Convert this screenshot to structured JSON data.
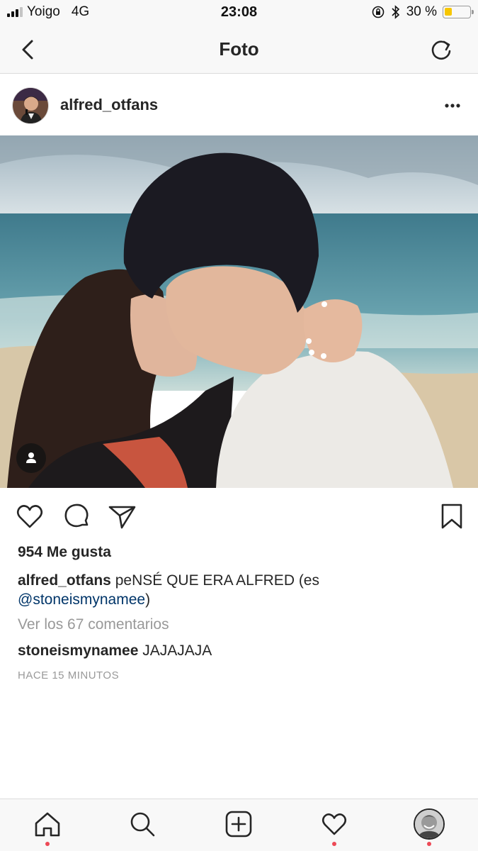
{
  "status_bar": {
    "carrier": "Yoigo",
    "network": "4G",
    "time": "23:08",
    "battery_text": "30 %",
    "battery_level": 0.3,
    "battery_color": "#f7c600"
  },
  "nav": {
    "title": "Foto",
    "back_icon": "chevron-left-icon",
    "refresh_icon": "refresh-icon"
  },
  "post": {
    "username": "alfred_otfans",
    "more_icon": "more-horizontal-icon",
    "tag_icon": "person-tag-icon",
    "likes": "954 Me gusta",
    "caption_user": "alfred_otfans",
    "caption_text": "peNSÉ QUE ERA ALFRED (es",
    "caption_mention": "@stoneismynamee",
    "caption_end": ")",
    "view_comments": "Ver los 67 comentarios",
    "comment_user": "stoneismynamee",
    "comment_text": "JAJAJAJA",
    "timestamp": "HACE 15 MINUTOS"
  },
  "actions": {
    "like_icon": "heart-icon",
    "comment_icon": "comment-icon",
    "share_icon": "send-icon",
    "save_icon": "bookmark-icon"
  },
  "tabbar": {
    "items": [
      "home-icon",
      "search-icon",
      "add-post-icon",
      "activity-heart-icon",
      "profile-avatar"
    ],
    "accent": "#ed4956"
  }
}
